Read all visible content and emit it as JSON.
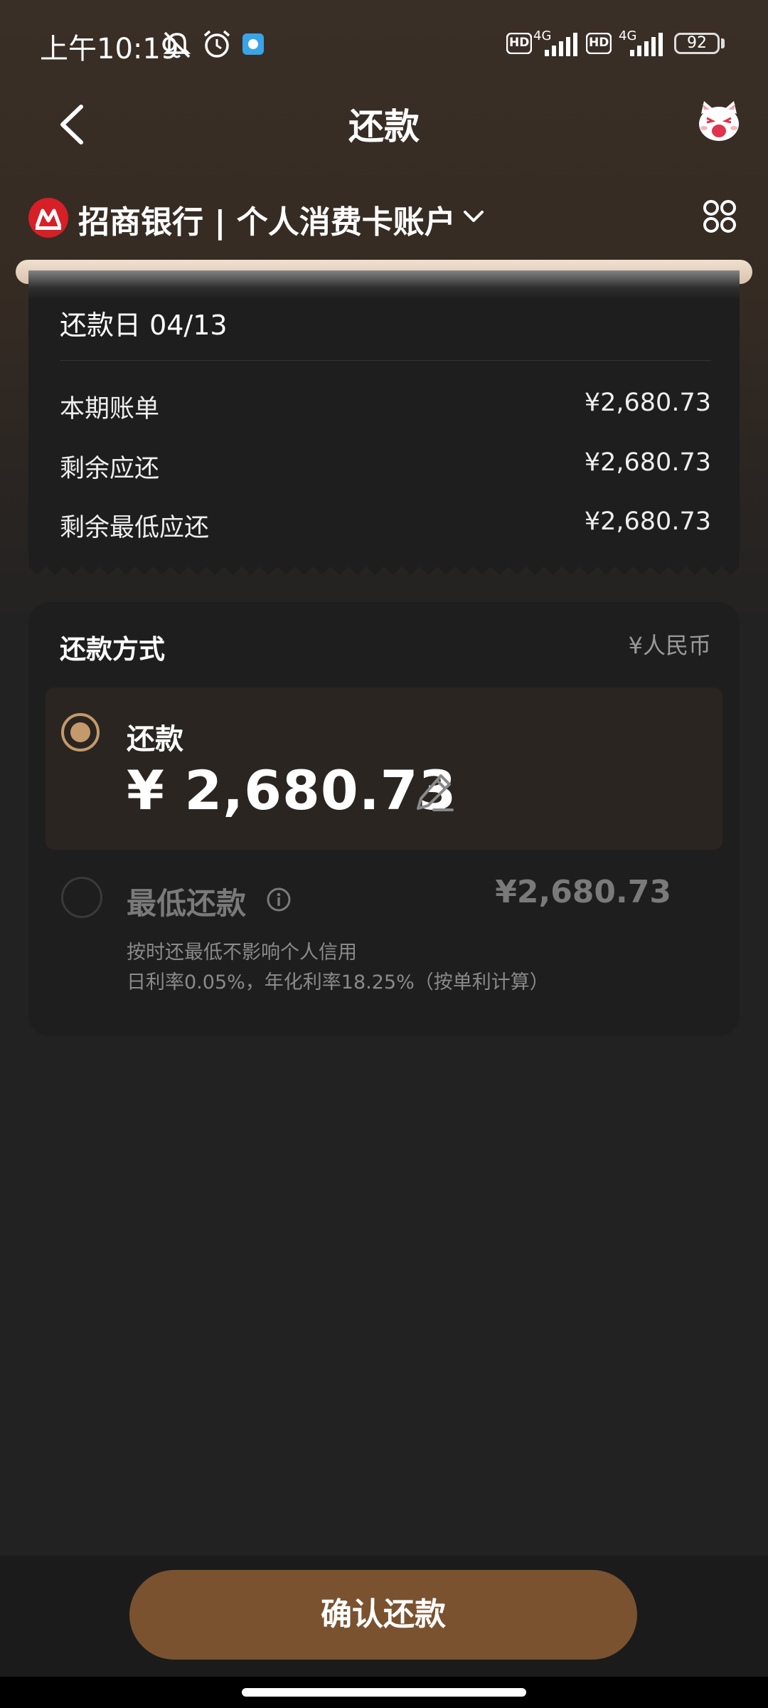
{
  "status_bar": {
    "time": "上午10:19",
    "network_1": "4G",
    "network_2": "4G",
    "hd_1": "HD",
    "hd_2": "HD",
    "battery": "92"
  },
  "nav": {
    "title": "还款",
    "back_icon": "chevron-left-icon",
    "mascot_icon": "cat-mascot-icon"
  },
  "account": {
    "name": "招商银行 | 个人消费卡账户",
    "logo_icon": "cmb-bank-logo-icon",
    "chevron_icon": "chevron-down-icon",
    "menu_icon": "grid-menu-icon"
  },
  "bill": {
    "due_date": "还款日 04/13",
    "rows": [
      {
        "label": "本期账单",
        "value": "¥2,680.73"
      },
      {
        "label": "剩余应还",
        "value": "¥2,680.73"
      },
      {
        "label": "剩余最低应还",
        "value": "¥2,680.73"
      }
    ]
  },
  "payment": {
    "title": "还款方式",
    "currency": "¥人民币",
    "full": {
      "label": "还款",
      "amount": "¥ 2,680.73",
      "selected": true
    },
    "minimum": {
      "label": "最低还款",
      "amount": "¥2,680.73",
      "note_1": "按时还最低不影响个人信用",
      "note_2": "日利率0.05%，年化利率18.25%（按单利计算）",
      "selected": false
    }
  },
  "actions": {
    "confirm_label": "确认还款"
  },
  "colors": {
    "accent": "#c49a6c",
    "button": "#7a5230",
    "bank_red": "#d61f26"
  }
}
